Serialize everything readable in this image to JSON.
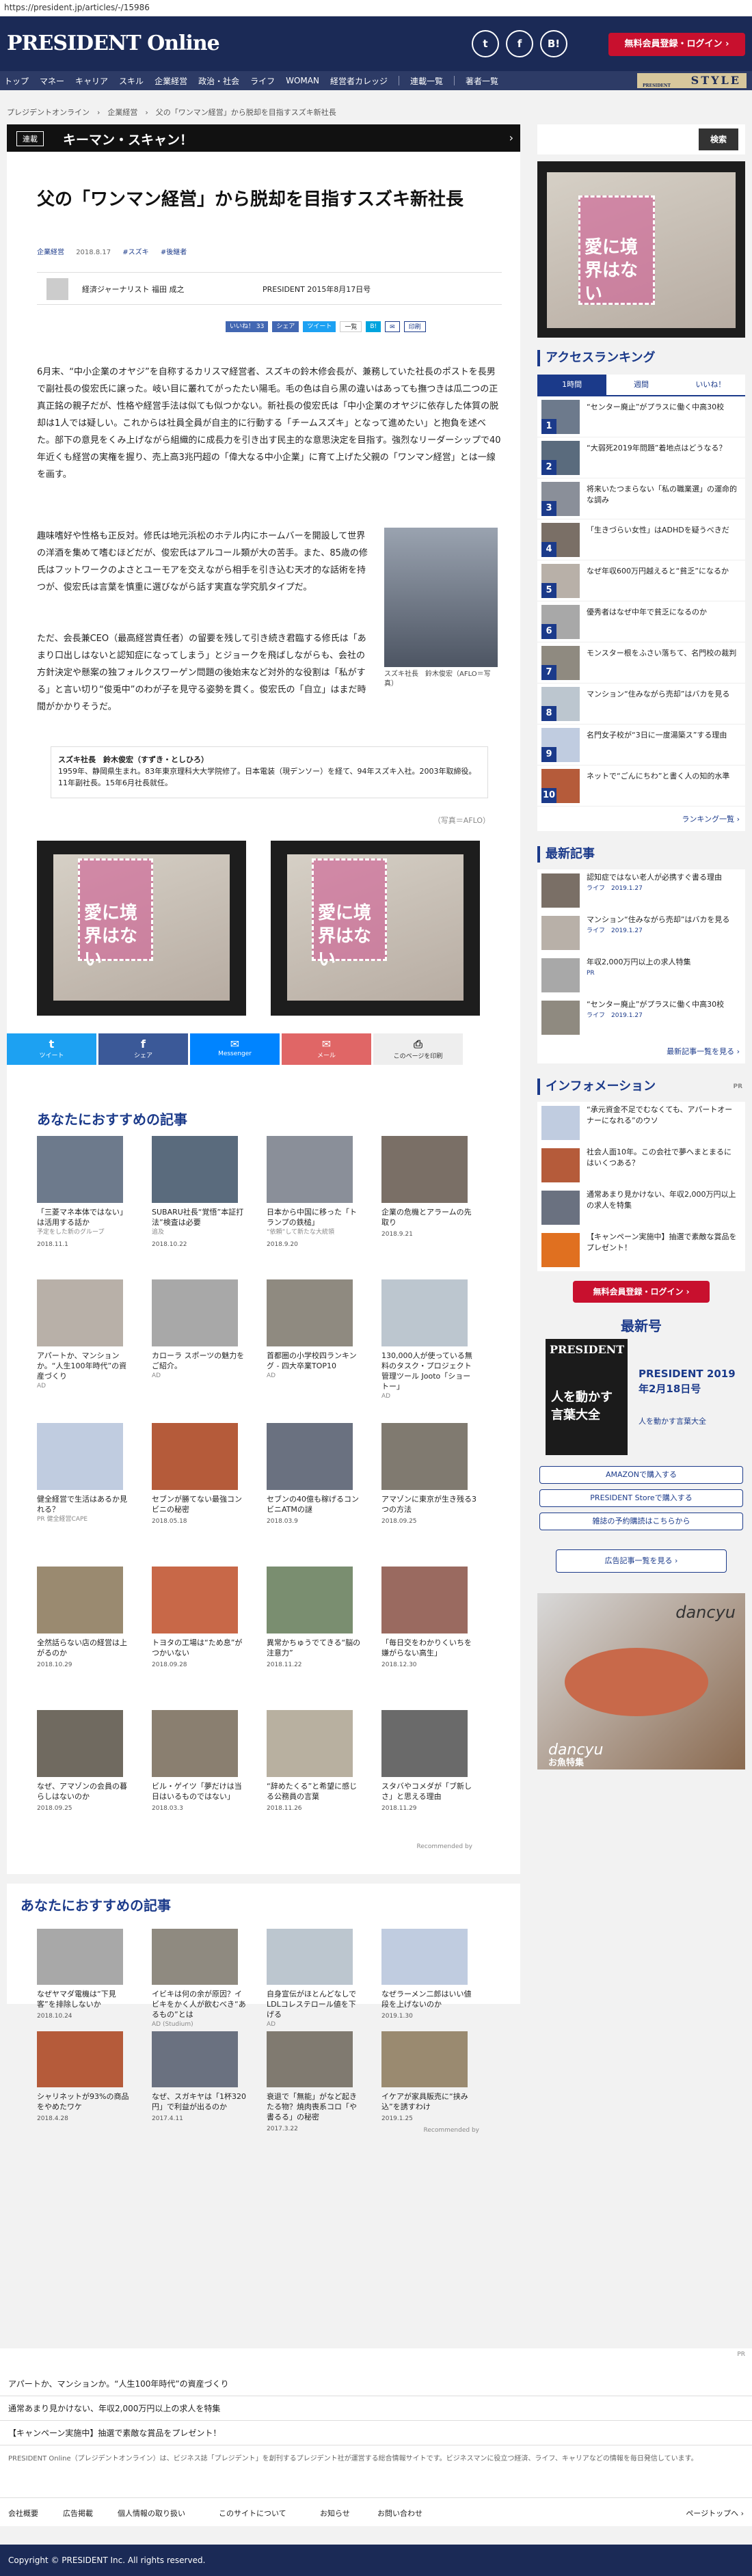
{
  "url": "https://president.jp/articles/-/15986",
  "header": {
    "logo": "PRESIDENT Online",
    "member_btn": "無料会員登録・ログイン ›",
    "icons": [
      "twitter-icon",
      "facebook-icon",
      "hatena-icon"
    ]
  },
  "nav": [
    "トップ",
    "マネー",
    "キャリア",
    "スキル",
    "企業経営",
    "政治・社会",
    "ライフ",
    "WOMAN",
    "経営者カレッジ",
    "連載一覧",
    "著者一覧"
  ],
  "style_label": "STYLE",
  "style_small": "PRESIDENT",
  "breadcrumb": "プレジデントオンライン　›　企業経営　›　父の「ワンマン経営」から脱却を目指すスズキ新社長",
  "series": {
    "tag": "連載",
    "title": "キーマン・スキャン！"
  },
  "article": {
    "title": "父の「ワンマン経営」から脱却を目指すスズキ新社長",
    "meta": [
      "企業経営",
      "2018.8.17",
      "#スズキ",
      "#後継者"
    ],
    "author": "経済ジャーナリスト 福田 成之",
    "source": "PRESIDENT 2015年8月17日号",
    "share": [
      "いいね！ 33",
      "シェア",
      "ツイート",
      "一覧",
      "B! ",
      "印刷"
    ],
    "lead": "6月末、“中小企業のオヤジ”を自称するカリスマ経営者、スズキの鈴木修会長が、兼務していた社長のポストを長男で副社長の俊宏氏に譲った。岐い目に叢れてがったたい陽毛。毛の色は自ら黒の違いはあっても撫つきは瓜二つの正真正銘の親子だが、性格や経営手法は似ても似つかない。新社長の俊宏氏は「中小企業のオヤジに依存した体質の脱却は1人では疑しい。これからは社員全員が自主的に行動する「チームスズキ」となって進めたい」と抱負を述べた。部下の意見をくみ上げながら組織的に成長力を引き出す民主的な意思決定を目指す。強烈なリーダーシップで40年近くも経営の実権を握り、売上高3兆円超の「偉大なる中小企業」に育て上げた父親の「ワンマン経営」とは一線を画す。",
    "para2": "趣味嗜好や性格も正反対。修氏は地元浜松のホテル内にホームバーを開設して世界の洋酒を集めて嗜むほどだが、俊宏氏はアルコール類が大の苦手。また、85歳の修氏はフットワークのよさとユーモアを交えながら相手を引き込む天才的な話術を持つが、俊宏氏は言葉を慎重に選びながら話す実直な学究肌タイプだ。",
    "para3": "ただ、会長兼CEO（最高経営責任者）の留要を残して引き続き君臨する修氏は「あまり口出しはないと認知症になってしまう」とジョークを飛ばしながらも、会社の方針決定や懸案の独フォルクスワーゲン問題の後始末など対外的な役割は「私がする」と言い切り“俊兎中”のわが子を見守る姿勢を貫く。俊宏氏の「自立」はまだ時間がかかりそうだ。",
    "caption": "スズキ社長　鈴木俊宏（AFLO＝写真）",
    "profile_name": "スズキ社長　鈴木俊宏（すずき・としひろ）",
    "profile_body": "1959年、静岡県生まれ。83年東京理科大大学院修了。日本電装（現デンソー）を経て、94年スズキ入社。2003年取締役。11年副社長。15年6月社長就任。",
    "credit": "（写真＝AFLO）"
  },
  "ad_text": "愛に境界はない",
  "share_buttons": [
    {
      "label": "ツイート",
      "icon": "twitter-icon",
      "color": "#1da1f2"
    },
    {
      "label": "シェア",
      "icon": "facebook-icon",
      "color": "#3b5998"
    },
    {
      "label": "Messenger",
      "icon": "messenger-icon",
      "color": "#0084ff"
    },
    {
      "label": "メール",
      "icon": "mail-icon",
      "color": "#e06666"
    },
    {
      "label": "このページを印刷",
      "icon": "print-icon",
      "color": "#eeeeee"
    }
  ],
  "rec1_title": "あなたにおすすめの記事",
  "rec1": [
    {
      "t": "「三菱マネ本体ではない」は活用する話か",
      "d": "2018.11.1",
      "s": "予定をした新のグループ"
    },
    {
      "t": "SUBARU社長“覚悟”本証打法”検査は必要",
      "d": "2018.10.22",
      "s": "追及"
    },
    {
      "t": "日本から中国に移った「トランプの鉄槌」",
      "d": "2018.9.20",
      "s": "“依頼”して新たな大統領"
    },
    {
      "t": "企業の危機とアラームの先取り",
      "d": "2018.9.21",
      "s": ""
    },
    {
      "t": "アパートか、マンションか。“人生100年時代”の資産づくり",
      "d": "",
      "s": "AD"
    },
    {
      "t": "カローラ スポーツの魅力をご紹介。",
      "d": "",
      "s": "AD"
    },
    {
      "t": "首都圏の小学校四ランキング - 四大卒業TOP10",
      "d": "",
      "s": "AD"
    },
    {
      "t": "130,000人が使っている無料のタスク・プロジェクト管理ツール Jooto「ショートー」",
      "d": "",
      "s": "AD"
    },
    {
      "t": "健全経営で生活はあるか見れる？",
      "d": "",
      "s": "PR 健全経営CAPE"
    },
    {
      "t": "セブンが勝てない最強コンビニの秘密",
      "d": "2018.05.18",
      "s": ""
    },
    {
      "t": "セブンの40億も稼げるコンビニATMの謎",
      "d": "2018.03.9",
      "s": ""
    },
    {
      "t": "アマゾンに東京が生き残る3つの方法",
      "d": "2018.09.25",
      "s": ""
    },
    {
      "t": "全然話らない店の経営は上がるのか",
      "d": "2018.10.29",
      "s": ""
    },
    {
      "t": "トヨタの工場は“ため息”がつかいない",
      "d": "2018.09.28",
      "s": ""
    },
    {
      "t": "異常かちゅうでてきる“脳の注意力”",
      "d": "2018.11.22",
      "s": ""
    },
    {
      "t": "「毎日交をわかりくいちを嫌がらない高生」",
      "d": "2018.12.30",
      "s": ""
    },
    {
      "t": "なぜ、アマゾンの会員の暮らしはないのか",
      "d": "2018.09.25",
      "s": ""
    },
    {
      "t": "ビル・ゲイツ「夢だけは当日はいるものではない」",
      "d": "2018.03.3",
      "s": ""
    },
    {
      "t": "“辞めたくる”と希望に感じる公務員の言葉",
      "d": "2018.11.26",
      "s": ""
    },
    {
      "t": "スタバやコメダが「ブ新しさ」と思える理由",
      "d": "2018.11.29",
      "s": ""
    }
  ],
  "recommended_by": "Recommended by",
  "rec2_title": "あなたにおすすめの記事",
  "rec2": [
    {
      "t": "なぜヤマダ電機は“下見客”を排除しないか",
      "d": "2018.10.24",
      "s": ""
    },
    {
      "t": "イビキは何の余が原因？イビキをかく人が飲むべき“あるもの”とは",
      "d": "",
      "s": "AD (Studium)"
    },
    {
      "t": "自身宣伝がほとんどなしでLDLコレステロール値を下げる",
      "d": "",
      "s": "AD"
    },
    {
      "t": "なぜラーメン二郎はいい値段を上げないのか",
      "d": "2019.1.30",
      "s": ""
    },
    {
      "t": "シャリネットが93%の商品をやめたワケ",
      "d": "2018.4.28",
      "s": ""
    },
    {
      "t": "なぜ、スガキヤは「1杯320円」で利益が出るのか",
      "d": "2017.4.11",
      "s": ""
    },
    {
      "t": "衰退で「無能」がなど起きたる物？焼肉喪系コロ「や書るる」の秘密",
      "d": "2017.3.22",
      "s": ""
    },
    {
      "t": "イケアが家具販売に“挟み込”を誘すわけ",
      "d": "2019.1.25",
      "s": ""
    }
  ],
  "recommended_by2": "Recommended by",
  "side": {
    "search_btn": "検索",
    "ranking_title": "アクセスランキング",
    "tabs": [
      "1時間",
      "週間",
      "いいね！"
    ],
    "ranking": [
      "“センター廃止”がプラスに働く中高30校",
      "“大弱死2019年問題”着地点はどうなる？",
      "将来いたつまらない「私の職業選」の運命的な調み",
      "「生きづらい女性」はADHDを疑うべきだ",
      "なぜ年収600万円越えると“貧乏”になるか",
      "優秀者はなぜ中年で貧乏になるのか",
      "モンスター根をふさい落ちて、名門校の裁判",
      "マンション“住みながら売却”はバカを見る",
      "名門女子校が“3日に一度湯築ス”する理由",
      "ネットで“ごんにちわ”と書く人の知的水準"
    ],
    "ranking_more": "ランキング一覧 ›",
    "new_title": "最新記事",
    "new": [
      {
        "t": "認知症ではない老人が必携すぐ書る理由",
        "c": "ライフ　2019.1.27"
      },
      {
        "t": "マンション“住みながら売却”はバカを見る",
        "c": "ライフ　2019.1.27"
      },
      {
        "t": "年収2,000万円以上の求人特集",
        "c": "PR"
      },
      {
        "t": "“センター廃止”がプラスに働く中高30校",
        "c": "ライフ　2019.1.27"
      }
    ],
    "new_more": "最新記事一覧を見る ›",
    "info_title": "インフォメーション",
    "info_pr": "PR",
    "info": [
      "“承元資金不足でむなくても、アパートオーナーになれる”のウソ",
      "社会人面10年。この会社で夢へまとまるにはいくつある？",
      "通常あまり見かけない、年収2,000万円以上の求人を特集",
      "【キャンペーン実施中】抽選で素敵な賞品をプレゼント！"
    ],
    "member_btn2": "無料会員登録・ログイン ›",
    "latest_title": "最新号",
    "mag": {
      "title": "PRESIDENT 2019年2月18日号",
      "sub": "人を動かす言葉大全"
    },
    "mag_cover": [
      "PRESIDENT",
      "人を動かす",
      "言葉大全"
    ],
    "buy_btns": [
      "AMAZONで購入する",
      "PRESIDENT Storeで購入する",
      "雑誌の予約購読はこちらから"
    ],
    "ads_list_btn": "広告記事一覧を見る ›",
    "dancyu": "dancyu",
    "dancyu_sub": "お魚特集"
  },
  "footer": {
    "pr": "PR",
    "links": [
      "アパートか、マンションか。“人生100年時代”の資産づくり",
      "通常あまり見かけない、年収2,000万円以上の求人を特集",
      "【キャンペーン実施中】抽選で素敵な賞品をプレゼント！"
    ],
    "about": "PRESIDENT Online（プレジデントオンライン）は、ビジネス誌「プレジデント」を創刊するプレジデント社が運営する総合情報サイトです。ビジネスマンに役立つ経済、ライフ、キャリアなどの情報を毎日発信しています。",
    "bottom_links": [
      "会社概要",
      "広告掲載",
      "個人情報の取り扱い",
      "このサイトについて",
      "お知らせ",
      "お問い合わせ"
    ],
    "pagetop": "ページトップへ ›",
    "copyright": "Copyright © PRESIDENT Inc. All rights reserved."
  }
}
